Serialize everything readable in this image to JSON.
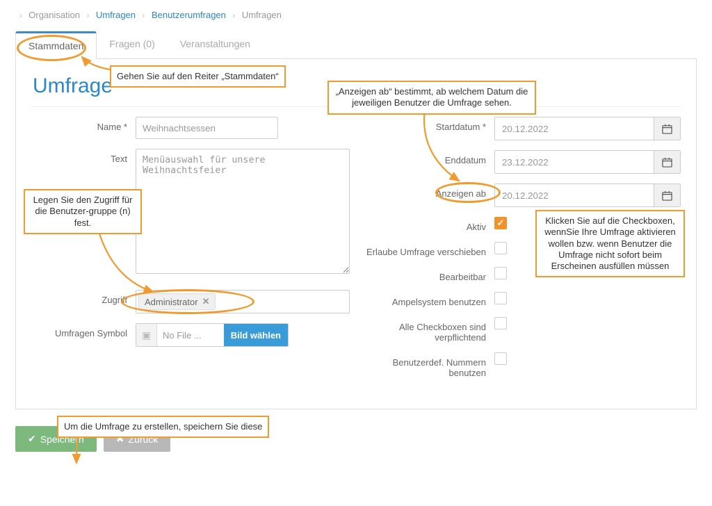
{
  "breadcrumb": {
    "root": "Organisation",
    "lvl1": "Umfragen",
    "lvl2": "Benutzerumfragen",
    "current": "Umfragen"
  },
  "tabs": {
    "t0": "Stammdaten",
    "t1": "Fragen (0)",
    "t2": "Veranstaltungen"
  },
  "title": "Umfrage",
  "left": {
    "name_label": "Name *",
    "name_value": "Weihnachtsessen",
    "text_label": "Text",
    "text_value": "Menüauswahl für unsere Weihnachtsfeier",
    "access_label": "Zugriff",
    "access_token": "Administrator",
    "symbol_label": "Umfragen Symbol",
    "file_placeholder": "No File ...",
    "file_button": "Bild wählen"
  },
  "right": {
    "start_label": "Startdatum *",
    "start_value": "20.12.2022",
    "end_label": "Enddatum",
    "end_value": "23.12.2022",
    "show_label": "Anzeigen ab",
    "show_value": "20.12.2022",
    "active_label": "Aktiv",
    "allowmove_label": "Erlaube Umfrage verschieben",
    "editable_label": "Bearbeitbar",
    "ampel_label": "Ampelsystem benutzen",
    "allrequired_label": "Alle Checkboxen sind verpflichtend",
    "usernum_label": "Benutzerdef. Nummern benutzen"
  },
  "buttons": {
    "save": "Speichern",
    "back": "Zurück"
  },
  "callouts": {
    "c_tabs": "Gehen Sie auf den Reiter „Stammdaten“",
    "c_show": "„Anzeigen ab“ bestimmt, ab welchem Datum die jeweiligen Benutzer die Umfrage sehen.",
    "c_access": "Legen Sie den Zugriff für die Benutzer-gruppe (n) fest.",
    "c_active": "Klicken Sie auf die Checkboxen, wennSie Ihre Umfrage aktivieren wollen bzw. wenn Benutzer die Umfrage nicht sofort beim Erscheinen ausfüllen müssen",
    "c_save": "Um die Umfrage zu erstellen, speichern Sie diese"
  }
}
